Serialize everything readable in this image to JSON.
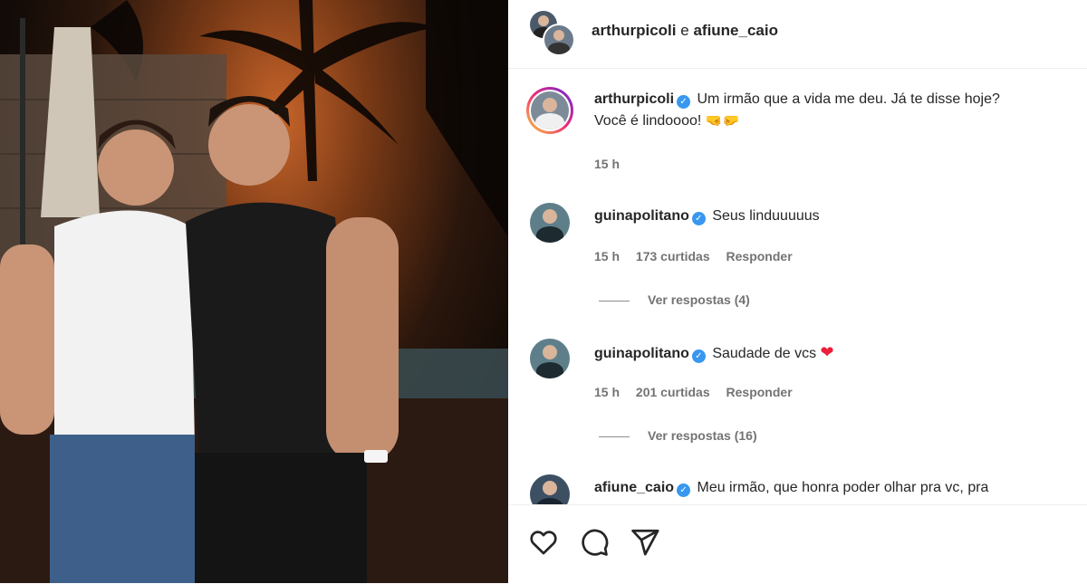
{
  "header": {
    "user1": "arthurpicoli",
    "sep": "e",
    "user2": "afiune_caio"
  },
  "caption": {
    "username": "arthurpicoli",
    "text_line1": "Um irmão que a vida me deu. Já te disse hoje?",
    "text_line2": "Você é lindoooo!",
    "emoji": "🤜🤛",
    "time": "15 h"
  },
  "comments": [
    {
      "username": "guinapolitano",
      "text": "Seus linduuuuus",
      "time": "15 h",
      "likes": "173 curtidas",
      "reply": "Responder",
      "view_replies": "Ver respostas (4)"
    },
    {
      "username": "guinapolitano",
      "text": "Saudade de vcs",
      "emoji": "❤",
      "time": "15 h",
      "likes": "201 curtidas",
      "reply": "Responder",
      "view_replies": "Ver respostas (16)"
    },
    {
      "username": "afiune_caio",
      "text": "Meu irmão, que honra poder olhar pra vc, pra"
    }
  ],
  "actions": [
    "heart-icon",
    "comment-icon",
    "share-icon"
  ],
  "colors": {
    "verified": "#3897f0",
    "meta": "#737373",
    "heart": "#ed1f3a"
  }
}
